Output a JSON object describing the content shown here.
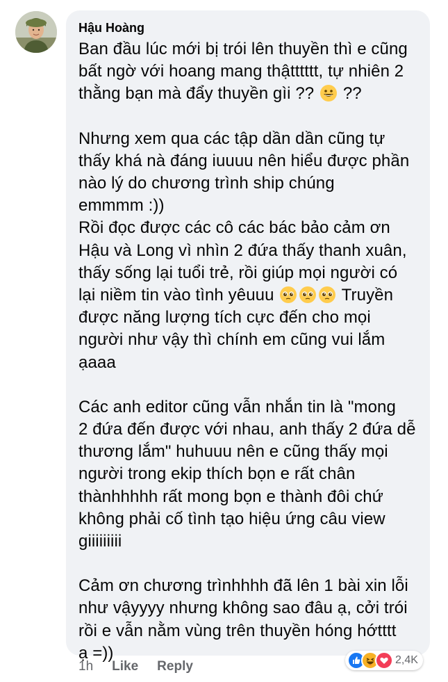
{
  "comment": {
    "author": "Hậu Hoàng",
    "paragraphs": [
      {
        "lines": [
          "Ban đầu lúc mới bị trói lên thuyền thì e cũng",
          "bất ngờ với hoang mang thậtttttt, tự nhiên 2",
          "thằng bạn mà đẩy thuyền gìi ??",
          "??"
        ]
      },
      {
        "lines": [
          "Nhưng xem qua các tập dần dần cũng tự",
          "thấy khá nà đáng iuuuu nên hiểu được phần",
          "nào lý do chương trình ship chúng",
          "emmmm :))",
          "Rồi đọc được các cô các bác bảo cảm ơn",
          "Hậu và Long vì nhìn 2 đứa thấy thanh xuân,",
          "thấy sống lại tuổi trẻ, rồi giúp mọi người có",
          "lại niềm tin vào tình yêuuu",
          "Truyền",
          "được năng lượng tích cực đến cho mọi",
          "người như vậy thì chính em cũng vui lắm",
          "ạaaa"
        ]
      },
      {
        "lines": [
          "Các anh editor cũng vẫn nhắn tin là \"mong",
          "2 đứa đến được với nhau, anh thấy 2 đứa dễ",
          "thương lắm\" huhuuu nên e cũng thấy mọi",
          "người trong ekip thích bọn e rất chân",
          "thànhhhhh rất mong bọn e thành đôi chứ",
          "không phải cố tình tạo hiệu ứng câu view",
          "giiiiiiiii"
        ]
      },
      {
        "lines": [
          "Cảm ơn chương trìnhhhh đã lên 1 bài xin lỗi",
          "như vậyyyy nhưng không sao đâu ạ, cởi trói",
          "rồi e vẫn nằm vùng trên thuyền hóng hớtttt",
          "ạ =))"
        ]
      }
    ],
    "emojis": [
      "grinning-face-icon",
      "pleading-face-icon",
      "pleading-face-icon",
      "pleading-face-icon"
    ],
    "time": "1h",
    "like_label": "Like",
    "reply_label": "Reply",
    "reactions": {
      "icons": [
        "like-reaction-icon",
        "haha-reaction-icon",
        "love-reaction-icon"
      ],
      "count": "2,4K"
    }
  },
  "colors": {
    "bubble": "#f0f2f5",
    "text": "#050505",
    "secondary": "#65676b",
    "like_blue": "#1877f2",
    "haha_yellow": "#f7b125",
    "love_red": "#f33e58"
  }
}
